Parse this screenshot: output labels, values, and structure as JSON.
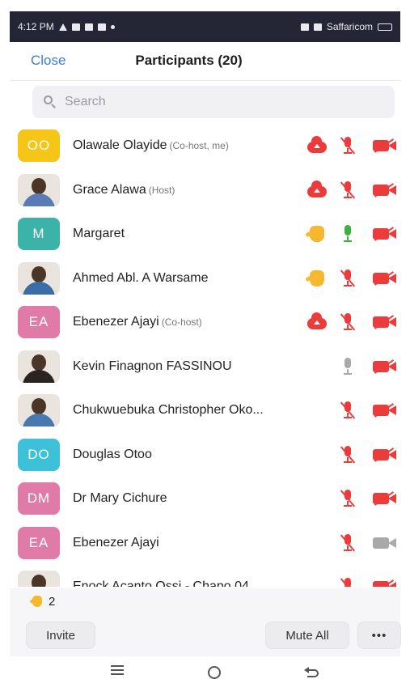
{
  "status_bar": {
    "time": "4:12 PM",
    "left_icons": [
      "warning-icon",
      "gmail-icon",
      "message-icon",
      "whatsapp-icon",
      "dot-icon"
    ],
    "right_text": "Saffaricom",
    "right_icons": [
      "vibrate-icon",
      "wifi-icon",
      "signal-icon",
      "battery-icon"
    ]
  },
  "header": {
    "close_label": "Close",
    "title": "Participants (20)"
  },
  "search": {
    "placeholder": "Search"
  },
  "participants": [
    {
      "name": "Olawale Olayide",
      "role": "(Co-host, me)",
      "avatar_type": "initials",
      "initials": "OO",
      "avatar_color": "#f5c518",
      "status_icons": [
        "cloud-record-icon"
      ],
      "mic": "muted",
      "camera": "off"
    },
    {
      "name": "Grace Alawa",
      "role": "(Host)",
      "avatar_type": "photo",
      "initials": "",
      "avatar_color": "#5a7bb5",
      "status_icons": [
        "cloud-record-icon"
      ],
      "mic": "muted",
      "camera": "off"
    },
    {
      "name": "Margaret",
      "role": "",
      "avatar_type": "initials",
      "initials": "M",
      "avatar_color": "#3bb3a8",
      "status_icons": [
        "raised-hand-icon"
      ],
      "mic": "live",
      "camera": "off"
    },
    {
      "name": "Ahmed Abl. A Warsame",
      "role": "",
      "avatar_type": "photo",
      "initials": "",
      "avatar_color": "#3b6ea8",
      "status_icons": [
        "raised-hand-icon"
      ],
      "mic": "muted",
      "camera": "off"
    },
    {
      "name": "Ebenezer Ajayi",
      "role": "(Co-host)",
      "avatar_type": "initials",
      "initials": "EA",
      "avatar_color": "#e07aa6",
      "status_icons": [
        "cloud-record-icon"
      ],
      "mic": "muted",
      "camera": "off"
    },
    {
      "name": "Kevin Finagnon FASSINOU",
      "role": "",
      "avatar_type": "photo",
      "initials": "",
      "avatar_color": "#2b2320",
      "status_icons": [],
      "mic": "idle",
      "camera": "off"
    },
    {
      "name": "Chukwuebuka Christopher Oko...",
      "role": "",
      "avatar_type": "photo",
      "initials": "",
      "avatar_color": "#4a78b0",
      "status_icons": [],
      "mic": "muted",
      "camera": "off"
    },
    {
      "name": "Douglas Otoo",
      "role": "",
      "avatar_type": "initials",
      "initials": "DO",
      "avatar_color": "#3cc1d8",
      "status_icons": [],
      "mic": "muted",
      "camera": "off"
    },
    {
      "name": "Dr Mary Cichure",
      "role": "",
      "avatar_type": "initials",
      "initials": "DM",
      "avatar_color": "#e07aa6",
      "status_icons": [],
      "mic": "muted",
      "camera": "off"
    },
    {
      "name": "Ebenezer Ajayi",
      "role": "",
      "avatar_type": "initials",
      "initials": "EA",
      "avatar_color": "#e07aa6",
      "status_icons": [],
      "mic": "muted",
      "camera": "on"
    },
    {
      "name": "Enock Acanto Ossi - Chapo 04",
      "role": "",
      "avatar_type": "photo",
      "initials": "",
      "avatar_color": "#6b5a4e",
      "status_icons": [],
      "mic": "muted",
      "camera": "off"
    }
  ],
  "raised_hands": {
    "count": "2"
  },
  "actions": {
    "invite_label": "Invite",
    "mute_all_label": "Mute All",
    "more_label": "•••"
  },
  "nav_bar": {
    "icons": [
      "recent-apps-icon",
      "home-icon",
      "back-icon"
    ]
  },
  "colors": {
    "accent": "#3a7ed6",
    "muted_red": "#ec3b3b",
    "raised_hand": "#f5b82e",
    "live_mic": "#3cb043",
    "status_bar_bg": "#242636"
  }
}
